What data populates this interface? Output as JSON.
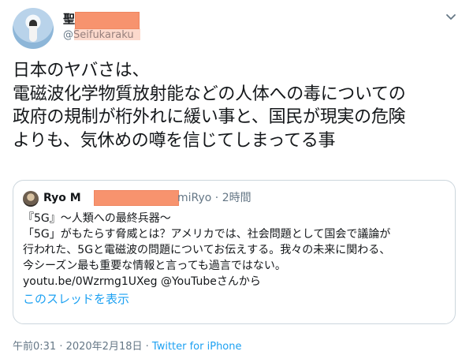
{
  "tweet": {
    "display_name": "聖",
    "handle": "@Seifukaraku",
    "text_lines": [
      "日本のヤバさは、",
      "電磁波化学物質放射能などの人体への毒についての",
      "政府の規制が桁外れに緩い事と、国民が現実の危険",
      "よりも、気休めの噂を信じてしまってる事"
    ],
    "timestamp": "午前0:31 · 2020年2月18日 ·",
    "source": "Twitter for iPhone"
  },
  "quoted": {
    "name": "Ryo M",
    "handle_tail": "miRyo",
    "time": "· 2時間",
    "body_lines": [
      "『5G』～人類への最終兵器～",
      "「5G」がもたらす脅威とは？アメリカでは、社会問題として国会で議論が",
      "行われた、5Gと電磁波の問題についてお伝えする。我々の未来に関わる、",
      "今シーズン最も重要な情報と言っても過言ではない。",
      "youtu.be/0Wzrmg1UXeg @YouTubeさんから"
    ],
    "show_thread": "このスレッドを表示"
  },
  "colors": {
    "accent": "#1da1f2",
    "muted": "#657786",
    "redaction": "#f7936e"
  },
  "icons": {
    "menu": "chevron-down-icon"
  }
}
